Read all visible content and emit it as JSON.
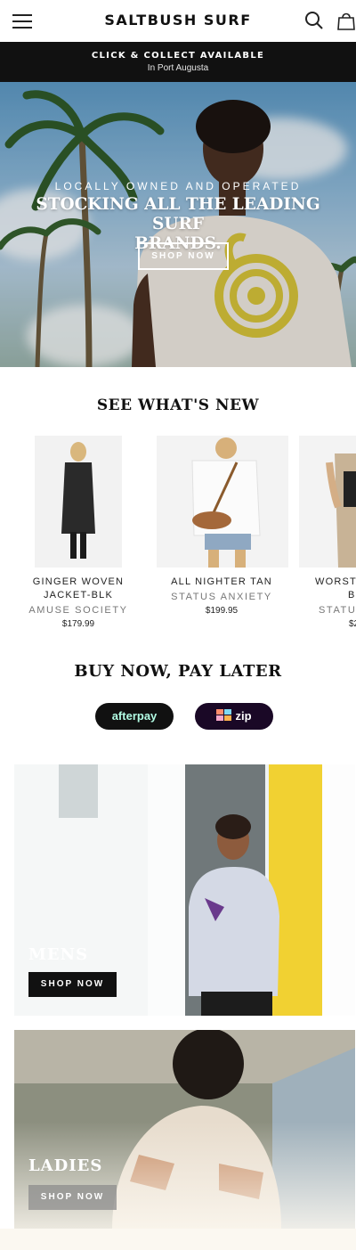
{
  "header": {
    "brand": "SALTBUSH SURF",
    "menu_icon": "hamburger-menu-icon",
    "search_icon": "search-icon",
    "cart_icon": "shopping-bag-icon"
  },
  "announcement": {
    "title": "CLICK & COLLECT AVAILABLE",
    "subtitle": "In Port Augusta"
  },
  "hero": {
    "eyebrow": "LOCALLY OWNED AND OPERATED",
    "headline_line1": "STOCKING ALL THE LEADING SURF",
    "headline_line2": "BRANDS.",
    "button": "SHOP NOW"
  },
  "new_arrivals": {
    "title": "SEE WHAT'S NEW",
    "products": [
      {
        "name_line1": "GINGER WOVEN",
        "name_line2": "JACKET-BLK",
        "brand": "AMUSE SOCIETY",
        "price": "$179.99"
      },
      {
        "name_line1": "ALL NIGHTER TAN",
        "name_line2": "",
        "brand": "STATUS ANXIETY",
        "price": "$199.95"
      },
      {
        "name_line1": "WORST",
        "name_line2": "B",
        "brand": "STATUS",
        "price": "$2"
      }
    ]
  },
  "payments": {
    "title": "BUY NOW, PAY LATER",
    "afterpay": "afterpay",
    "zip": "zip"
  },
  "categories": [
    {
      "title": "MENS",
      "button": "SHOP NOW"
    },
    {
      "title": "LADIES",
      "button": "SHOP NOW"
    }
  ],
  "colors": {
    "announcement_bg": "#111111",
    "afterpay_mint": "#b2fce4",
    "zip_purple": "#1a0826",
    "door_yellow": "#f1d132"
  }
}
